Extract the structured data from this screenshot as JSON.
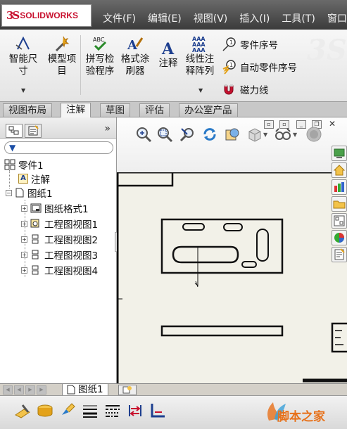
{
  "app": {
    "logo_mark": "3S",
    "logo_text": "SOLIDWORKS"
  },
  "menu": [
    {
      "label": "文件(F)"
    },
    {
      "label": "编辑(E)"
    },
    {
      "label": "视图(V)"
    },
    {
      "label": "插入(I)"
    },
    {
      "label": "工具(T)"
    },
    {
      "label": "窗口("
    }
  ],
  "ribbon": {
    "smart_dimension": {
      "line1": "智能尺",
      "line2": "寸",
      "icon": "smart-dimension-icon"
    },
    "model_items": {
      "line1": "模型项",
      "line2": "目",
      "icon": "model-items-icon"
    },
    "spell_check": {
      "line1": "拼写检",
      "line2": "验程序",
      "icon": "spell-check-icon"
    },
    "format_painter": {
      "line1": "格式涂",
      "line2": "刷器",
      "icon": "format-painter-icon"
    },
    "note": {
      "line1": "注释",
      "icon": "note-icon"
    },
    "linear_pattern": {
      "line1": "线性注",
      "line2": "释阵列",
      "icon": "linear-note-pattern-icon"
    },
    "balloon": {
      "label": "零件序号",
      "icon": "balloon-icon"
    },
    "auto_balloon": {
      "label": "自动零件序号",
      "icon": "auto-balloon-icon"
    },
    "magnetic_line": {
      "label": "磁力线",
      "icon": "magnet-icon"
    }
  },
  "command_tabs": [
    {
      "label": "视图布局",
      "active": false
    },
    {
      "label": "注解",
      "active": true
    },
    {
      "label": "草图",
      "active": false
    },
    {
      "label": "评估",
      "active": false
    },
    {
      "label": "办公室产品",
      "active": false
    }
  ],
  "feature_tree": {
    "filter_icon": "filter-icon",
    "items": [
      {
        "label": "零件1",
        "icon": "drawing-icon"
      },
      {
        "label": "注解",
        "icon": "annotations-icon",
        "icon_text": "A"
      },
      {
        "label": "图纸1",
        "icon": "sheet-icon"
      },
      {
        "label": "图纸格式1",
        "icon": "sheet-format-icon"
      },
      {
        "label": "工程图视图1",
        "icon": "drawing-view-icon"
      },
      {
        "label": "工程图视图2",
        "icon": "drawing-view-icon"
      },
      {
        "label": "工程图视图3",
        "icon": "drawing-view-icon"
      },
      {
        "label": "工程图视图4",
        "icon": "drawing-view-icon"
      }
    ]
  },
  "sheet_tabs": {
    "active_sheet": "图纸1"
  },
  "watermark": {
    "text": "脚本之家"
  },
  "colors": {
    "brand_red": "#c8102e",
    "sheet_bg": "#f2f1e8",
    "menu_bg": "#4a4a4a"
  }
}
